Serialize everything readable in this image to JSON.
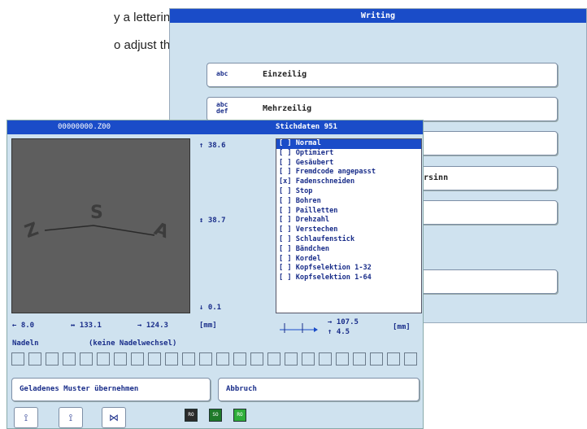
{
  "background_text": {
    "line1": "y a lettering",
    "line2": "o adjust the"
  },
  "writing_window": {
    "title": "Writing",
    "buttons": [
      {
        "icon_text": "abc",
        "label": "Einzeilig"
      },
      {
        "icon_text": "abc def",
        "label": "Mehrzeilig"
      },
      {
        "icon_text": "",
        "label": ""
      },
      {
        "icon_text": "",
        "label": "rsinn"
      },
      {
        "icon_text": "",
        "label": ""
      },
      {
        "icon_text": "",
        "label": ""
      }
    ]
  },
  "stitch_window": {
    "title_left": "00000000.Z00",
    "title_right": "Stichdaten  951",
    "preview": {
      "letters": [
        "Z",
        "S",
        "A"
      ],
      "background_color": "#5e5e5e"
    },
    "vertical_dims": {
      "top": "↑ 38.6",
      "middle": "↕ 38.7",
      "bottom": "↓ 0.1"
    },
    "horizontal_dims": {
      "left": "← 8.0",
      "middle": "↔ 133.1",
      "right": "→ 124.3",
      "unit": "[mm]"
    },
    "options": [
      {
        "mark": "[ ]",
        "label": "Normal",
        "selected": true
      },
      {
        "mark": "[ ]",
        "label": "Optimiert",
        "selected": false
      },
      {
        "mark": "[ ]",
        "label": "Gesäubert",
        "selected": false
      },
      {
        "mark": "[ ]",
        "label": "Fremdcode angepasst",
        "selected": false
      },
      {
        "mark": "[x]",
        "label": "Fadenschneiden",
        "selected": false
      },
      {
        "mark": "[ ]",
        "label": "Stop",
        "selected": false
      },
      {
        "mark": "[ ]",
        "label": "Bohren",
        "selected": false
      },
      {
        "mark": "[ ]",
        "label": "Pailletten",
        "selected": false
      },
      {
        "mark": "[ ]",
        "label": "Drehzahl",
        "selected": false
      },
      {
        "mark": "[ ]",
        "label": "Verstechen",
        "selected": false
      },
      {
        "mark": "[ ]",
        "label": "Schlaufenstick",
        "selected": false
      },
      {
        "mark": "[ ]",
        "label": "Bändchen",
        "selected": false
      },
      {
        "mark": "[ ]",
        "label": "Kordel",
        "selected": false
      },
      {
        "mark": "[ ]",
        "label": "Kopfselektion 1-32",
        "selected": false
      },
      {
        "mark": "[ ]",
        "label": "Kopfselektion 1-64",
        "selected": false
      }
    ],
    "offset": {
      "x": "→ 107.5",
      "y": "↑ 4.5",
      "unit": "[mm]"
    },
    "needles_label": "Nadeln",
    "needles_value": "(keine Nadelwechsel)",
    "needle_box_count": 24,
    "accept_button": "Geladenes Muster übernehmen",
    "cancel_button": "Abbruch",
    "squares": [
      {
        "text": "RO",
        "color": "#2b2b2b"
      },
      {
        "text": "SO",
        "color": "#1f7a2a"
      },
      {
        "text": "RO",
        "color": "#2fae3a"
      }
    ],
    "colors": {
      "titlebar": "#1a4cc8",
      "window_bg": "#cfe2ef",
      "text": "#1a2e8a"
    }
  }
}
